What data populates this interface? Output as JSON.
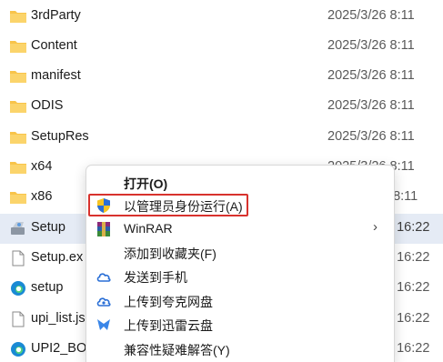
{
  "files": [
    {
      "name": "3rdParty",
      "date": "2025/3/26 8:11",
      "icon": "folder-icon"
    },
    {
      "name": "Content",
      "date": "2025/3/26 8:11",
      "icon": "folder-icon"
    },
    {
      "name": "manifest",
      "date": "2025/3/26 8:11",
      "icon": "folder-icon"
    },
    {
      "name": "ODIS",
      "date": "2025/3/26 8:11",
      "icon": "folder-icon"
    },
    {
      "name": "SetupRes",
      "date": "2025/3/26 8:11",
      "icon": "folder-icon"
    },
    {
      "name": "x64",
      "date": "2025/3/26 8:11",
      "icon": "folder-icon"
    },
    {
      "name": "x86",
      "date": "5 8:11",
      "icon": "folder-icon"
    },
    {
      "name": "Setup",
      "date": "3 16:22",
      "icon": "setup-installer-icon",
      "selected": true
    },
    {
      "name": "Setup.ex",
      "date": "3 16:22",
      "icon": "file-icon"
    },
    {
      "name": "setup",
      "date": "3 16:22",
      "icon": "edge-browser-icon"
    },
    {
      "name": "upi_list.js",
      "date": "3 16:22",
      "icon": "file-icon"
    },
    {
      "name": "UPI2_BO",
      "date": "3 16:22",
      "icon": "edge-browser-icon"
    }
  ],
  "context_menu": {
    "items": [
      {
        "label": "打开(O)",
        "icon": "",
        "bold": true
      },
      {
        "label": "以管理员身份运行(A)",
        "icon": "uac-shield-icon",
        "highlighted": true
      },
      {
        "label": "WinRAR",
        "icon": "winrar-icon",
        "submenu": "›"
      },
      {
        "label": "添加到收藏夹(F)",
        "icon": ""
      },
      {
        "label": "发送到手机",
        "icon": "cloud-send-icon"
      },
      {
        "label": "上传到夸克网盘",
        "icon": "quark-cloud-icon"
      },
      {
        "label": "上传到迅雷云盘",
        "icon": "xunlei-cloud-icon"
      },
      {
        "label": "兼容性疑难解答(Y)",
        "icon": ""
      }
    ]
  },
  "colors": {
    "folder": "#f8c44a",
    "selected_row": "#e5ebf5",
    "highlight_border": "#d8322d",
    "uac_blue": "#2a6fd6",
    "uac_yellow": "#f6c322"
  }
}
